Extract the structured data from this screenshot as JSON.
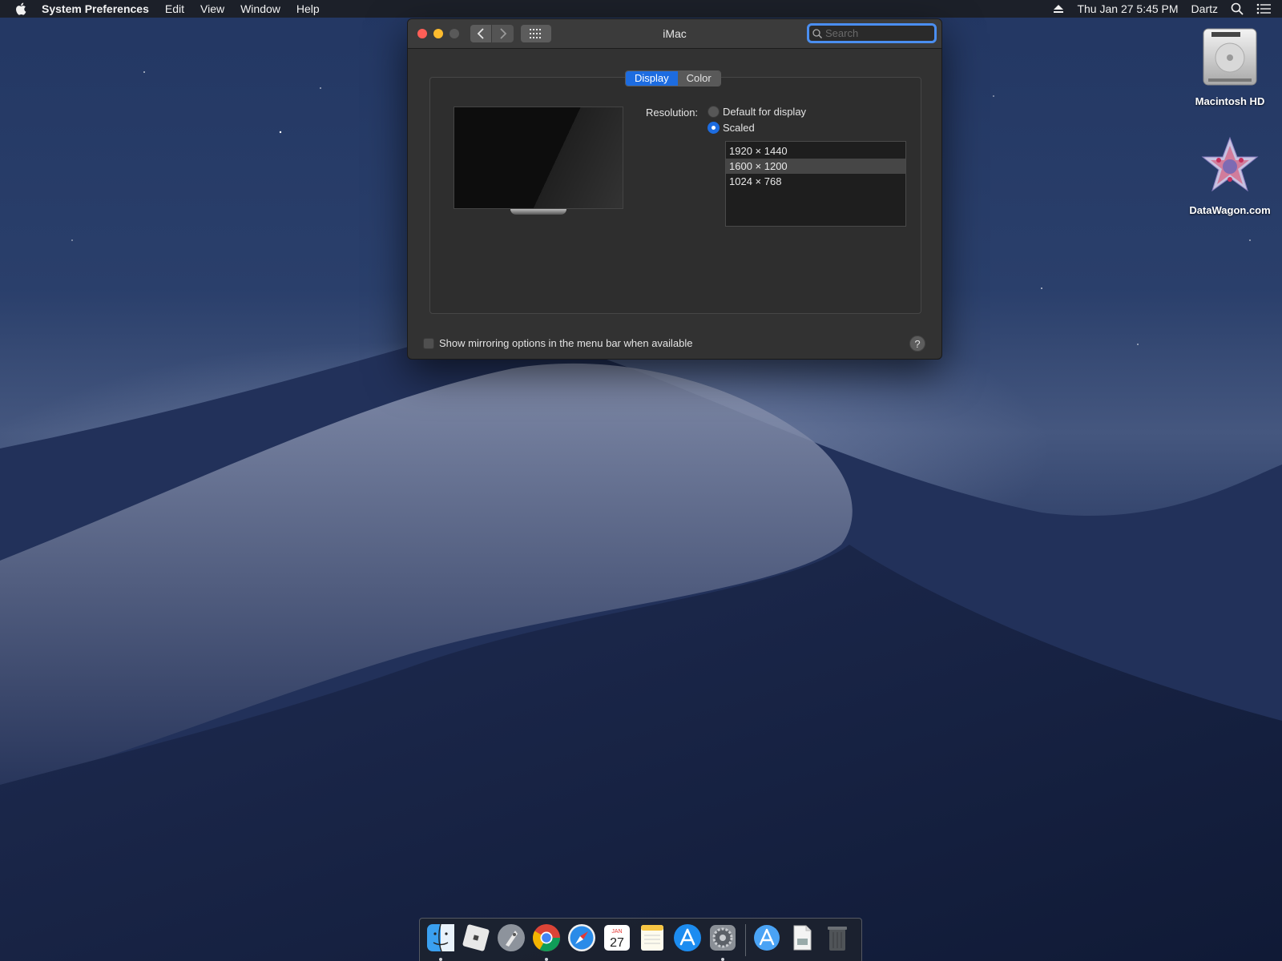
{
  "menubar": {
    "app_name": "System Preferences",
    "menus": [
      "Edit",
      "View",
      "Window",
      "Help"
    ],
    "clock": "Thu Jan 27  5:45 PM",
    "user": "Dartz"
  },
  "desktop": {
    "icons": [
      {
        "label": "Macintosh HD",
        "icon": "hard-drive-icon"
      },
      {
        "label": "DataWagon.com",
        "icon": "datawagon-logo-icon"
      }
    ]
  },
  "window": {
    "title": "iMac",
    "search_placeholder": "Search",
    "tabs": [
      {
        "label": "Display",
        "active": true
      },
      {
        "label": "Color",
        "active": false
      }
    ],
    "resolution_label": "Resolution:",
    "resolution_options": [
      {
        "label": "Default for display",
        "selected": false
      },
      {
        "label": "Scaled",
        "selected": true
      }
    ],
    "scaled_resolutions": [
      {
        "label": "1920 × 1440",
        "selected": false
      },
      {
        "label": "1600 × 1200",
        "selected": true
      },
      {
        "label": "1024 × 768",
        "selected": false
      }
    ],
    "mirroring_label": "Show mirroring options in the menu bar when available",
    "mirroring_checked": false,
    "help_label": "?"
  },
  "dock": {
    "calendar_day": "27",
    "calendar_month": "JAN",
    "apps": [
      "finder-icon",
      "roblox-icon",
      "launchpad-icon",
      "chrome-icon",
      "safari-icon",
      "calendar-icon",
      "notes-icon",
      "app-store-icon",
      "system-preferences-icon",
      "applications-folder-icon",
      "document-icon",
      "trash-icon"
    ]
  },
  "colors": {
    "accent": "#1d6ce0",
    "close": "#fe5f57",
    "minimize": "#febc2e"
  }
}
